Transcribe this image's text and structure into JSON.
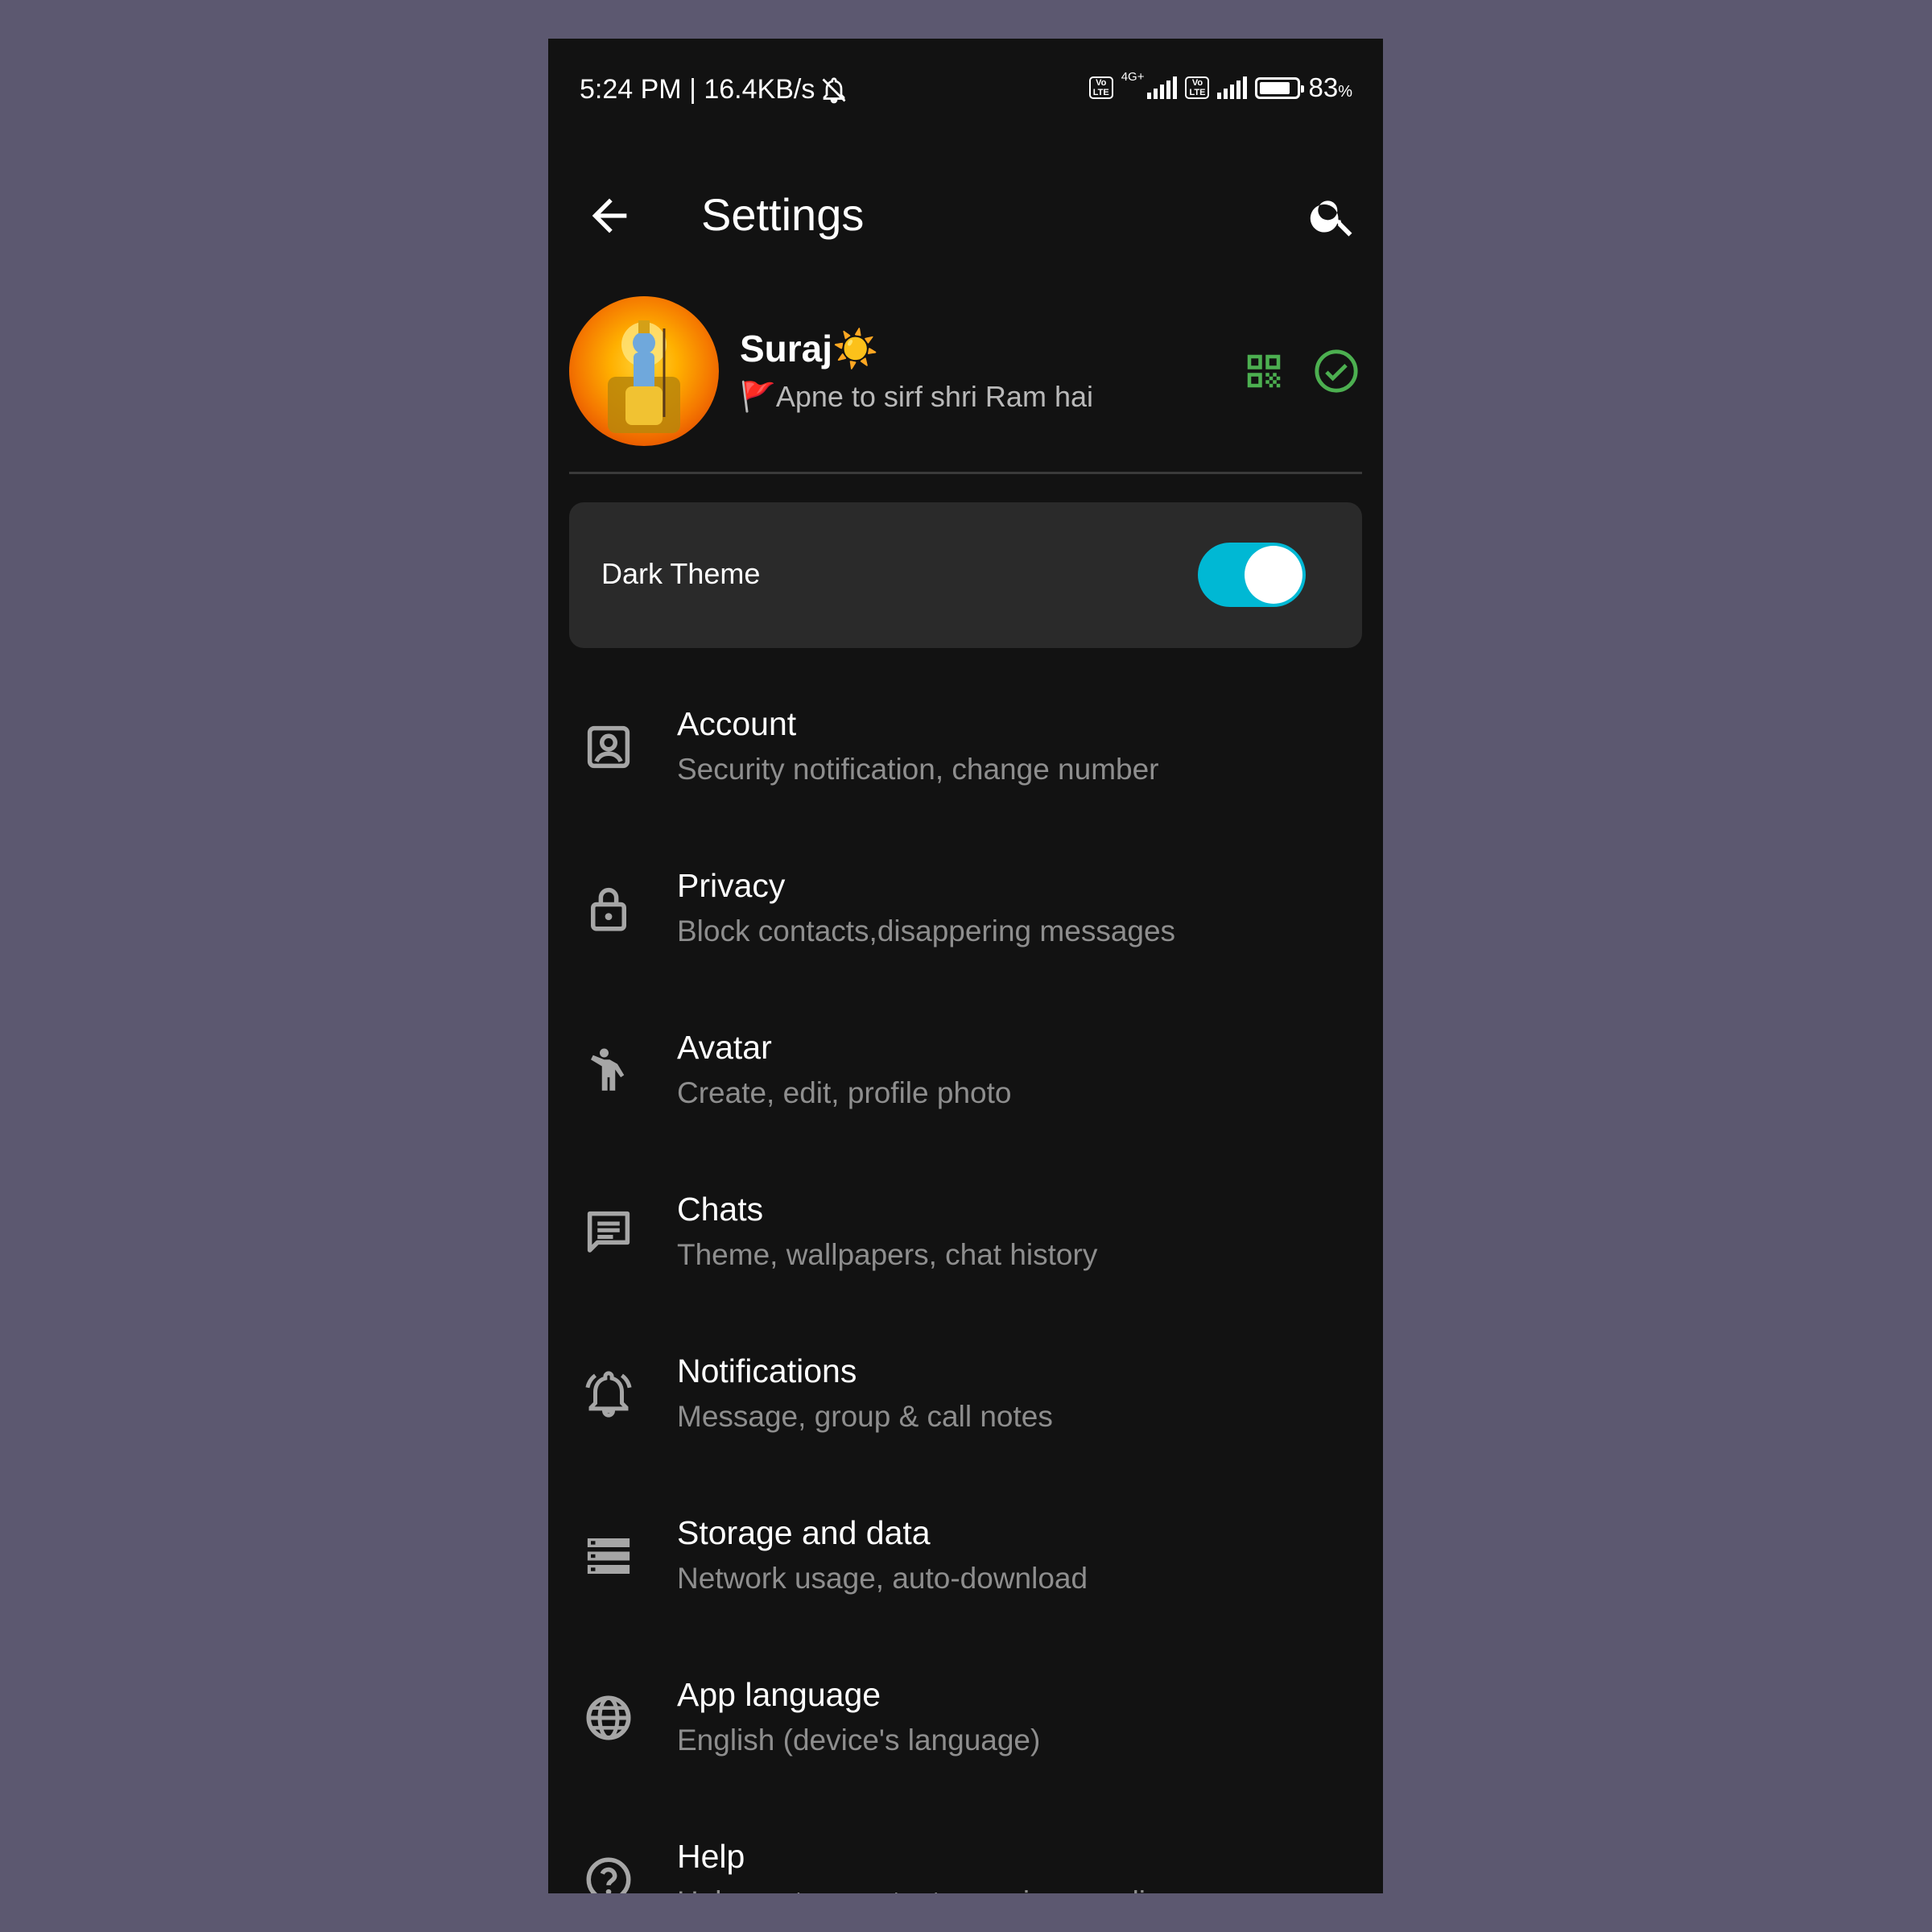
{
  "status_bar": {
    "time": "5:24 PM | 16.4KB/s",
    "network_type": "4G+",
    "volte_label": "Vo LTE",
    "battery_percent": "83",
    "battery_unit": "%",
    "battery_level": 0.83
  },
  "app_bar": {
    "title": "Settings",
    "back_icon": "arrow-back-icon",
    "search_icon": "search-icon"
  },
  "profile": {
    "name": "Suraj☀️",
    "status": "🚩Apne to sirf shri Ram hai",
    "qr_icon": "qr-code-icon",
    "check_icon": "check-circle-icon",
    "accent_color": "#4caf50"
  },
  "theme_toggle": {
    "label": "Dark Theme",
    "enabled": true,
    "accent_color": "#00b8d4"
  },
  "settings": [
    {
      "icon": "account-box-icon",
      "title": "Account",
      "subtitle": "Security notification, change number"
    },
    {
      "icon": "lock-icon",
      "title": "Privacy",
      "subtitle": "Block contacts,disappering messages"
    },
    {
      "icon": "person-wave-icon",
      "title": "Avatar",
      "subtitle": "Create, edit, profile photo"
    },
    {
      "icon": "chat-icon",
      "title": "Chats",
      "subtitle": "Theme, wallpapers, chat history"
    },
    {
      "icon": "notification-bell-icon",
      "title": "Notifications",
      "subtitle": "Message, group & call notes"
    },
    {
      "icon": "storage-icon",
      "title": "Storage and data",
      "subtitle": "Network usage, auto-download"
    },
    {
      "icon": "globe-icon",
      "title": "App language",
      "subtitle": "English (device's language)"
    },
    {
      "icon": "help-icon",
      "title": "Help",
      "subtitle": "Help center, contact us, privacy policy"
    }
  ]
}
